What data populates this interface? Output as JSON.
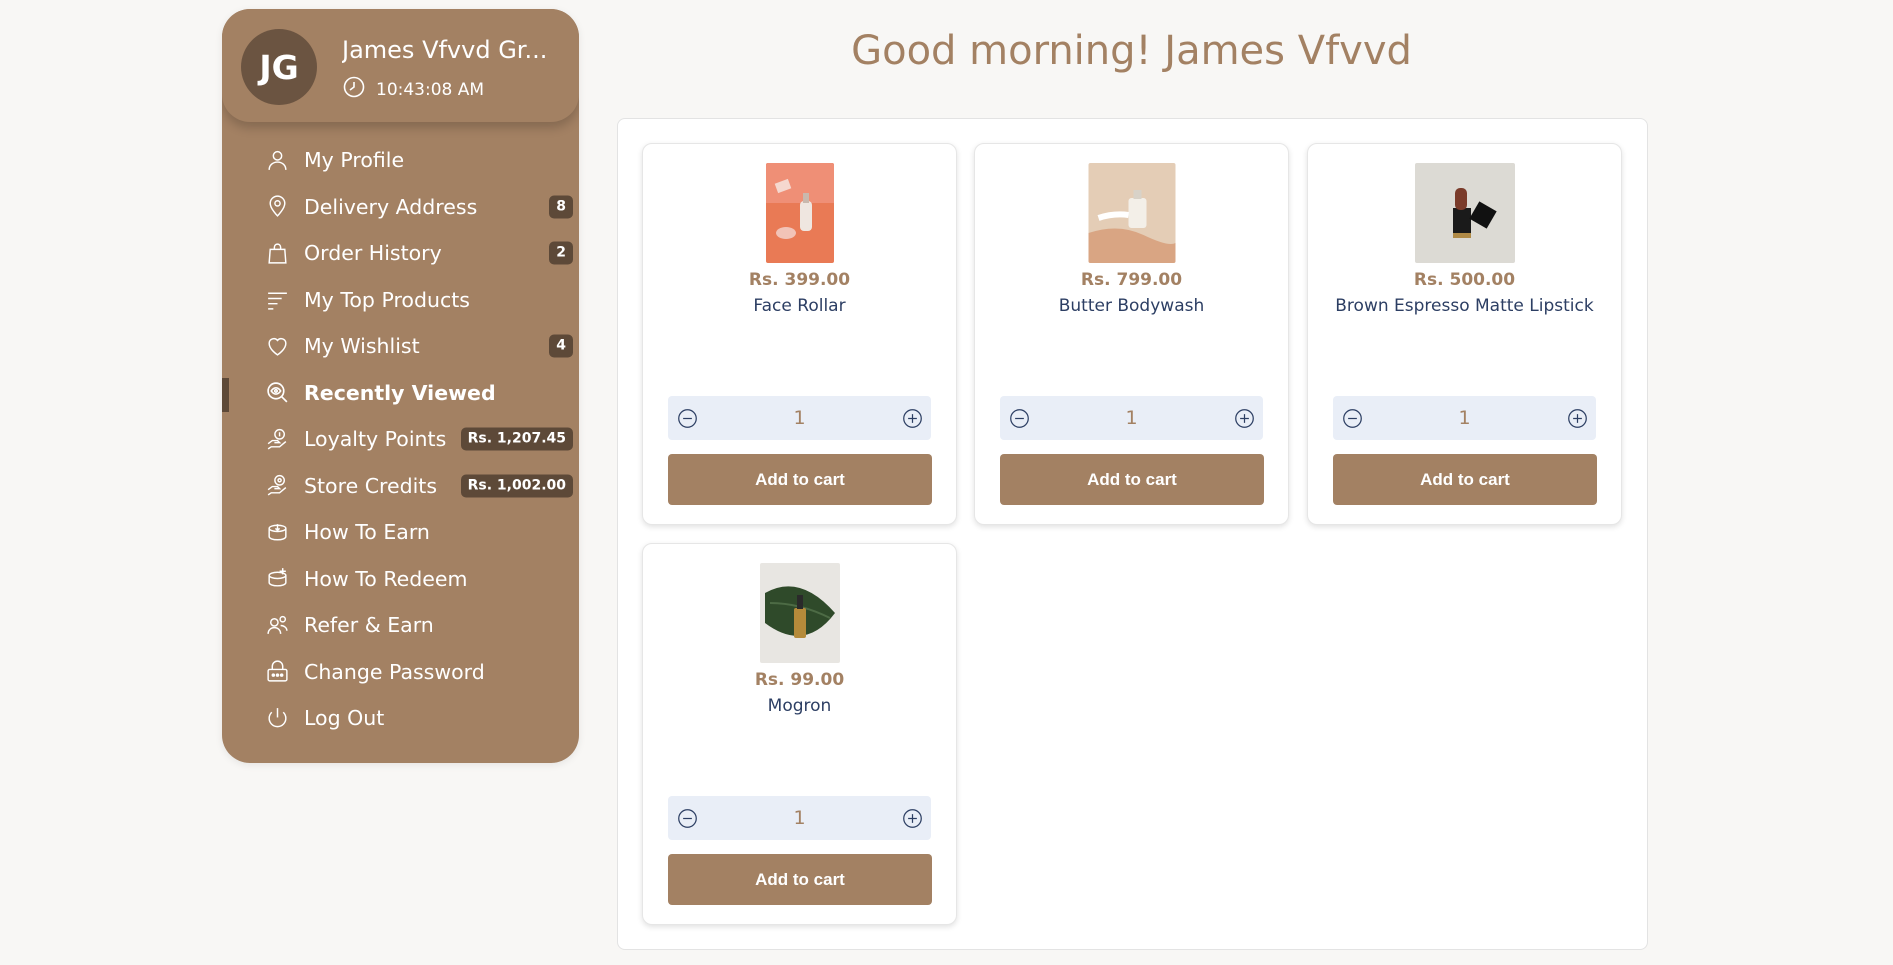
{
  "profile": {
    "initials": "JG",
    "name": "James Vfvvd Gr...",
    "time": "10:43:08 AM"
  },
  "menu": [
    {
      "label": "My Profile",
      "icon": "user-icon",
      "badge": ""
    },
    {
      "label": "Delivery Address",
      "icon": "location-pin-icon",
      "badge": "8"
    },
    {
      "label": "Order History",
      "icon": "shopping-bag-icon",
      "badge": "2"
    },
    {
      "label": "My Top Products",
      "icon": "sort-lines-icon",
      "badge": ""
    },
    {
      "label": "My Wishlist",
      "icon": "heart-icon",
      "badge": "4"
    },
    {
      "label": "Recently Viewed",
      "icon": "eye-search-icon",
      "badge": "",
      "active": true
    },
    {
      "label": "Loyalty Points",
      "icon": "coin-hand-icon",
      "badge": "Rs. 1,207.45"
    },
    {
      "label": "Store Credits",
      "icon": "credit-hand-icon",
      "badge": "Rs. 1,002.00"
    },
    {
      "label": "How To Earn",
      "icon": "earn-coins-icon",
      "badge": ""
    },
    {
      "label": "How To Redeem",
      "icon": "redeem-coins-icon",
      "badge": ""
    },
    {
      "label": "Refer & Earn",
      "icon": "refer-users-icon",
      "badge": ""
    },
    {
      "label": "Change Password",
      "icon": "lock-icon",
      "badge": ""
    },
    {
      "label": "Log Out",
      "icon": "power-icon",
      "badge": ""
    }
  ],
  "greeting": "Good morning! James Vfvvd",
  "products": [
    {
      "price": "Rs. 399.00",
      "name": "Face Rollar",
      "qty": "1",
      "button": "Add to cart"
    },
    {
      "price": "Rs. 799.00",
      "name": "Butter Bodywash",
      "qty": "1",
      "button": "Add to cart"
    },
    {
      "price": "Rs. 500.00",
      "name": "Brown Espresso Matte Lipstick",
      "qty": "1",
      "button": "Add to cart"
    },
    {
      "price": "Rs. 99.00",
      "name": "Mogron",
      "qty": "1",
      "button": "Add to cart"
    }
  ],
  "colors": {
    "accent": "#a38163",
    "dark_accent": "#5d4938",
    "text_blue": "#2c3e63"
  }
}
